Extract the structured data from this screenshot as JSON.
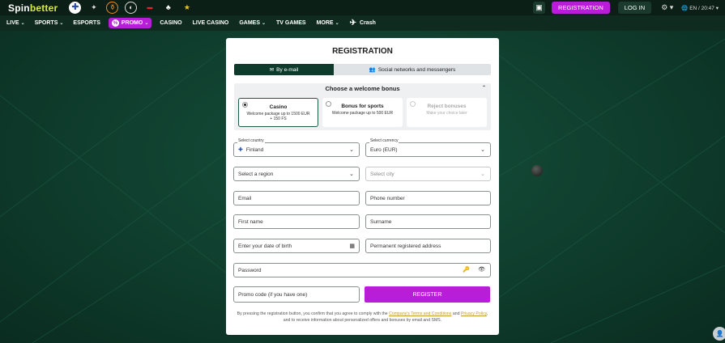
{
  "topbar": {
    "logo_left": "Spin",
    "logo_right": "better",
    "sport_icons": [
      "finland-flag-icon",
      "champions-league-icon",
      "europa-league-icon",
      "tennis-ball-icon",
      "ufc-icon",
      "cricket-icon",
      "stars-icon"
    ],
    "registration_label": "Registration",
    "login_label": "Log in",
    "lang": "EN",
    "time": "20:47"
  },
  "nav": {
    "items": [
      "Live",
      "Sports",
      "Esports",
      "Promo",
      "Casino",
      "Live Casino",
      "Games",
      "TV Games",
      "More",
      "Crash"
    ]
  },
  "form": {
    "title": "REGISTRATION",
    "tab_email": "By e-mail",
    "tab_social": "Social networks and messengers",
    "bonus_heading": "Choose a welcome bonus",
    "bonuses": [
      {
        "title": "Casino",
        "desc": "Welcome package up to 1500 EUR + 150 FS",
        "selected": true
      },
      {
        "title": "Bonus for sports",
        "desc": "Welcome package up to 500 EUR",
        "selected": false
      },
      {
        "title": "Reject bonuses",
        "desc": "Make your choice later",
        "selected": false
      }
    ],
    "country_label": "Select country",
    "country_value": "Finland",
    "currency_label": "Select currency",
    "currency_value": "Euro (EUR)",
    "region_placeholder": "Select a region",
    "city_placeholder": "Select city",
    "email_placeholder": "Email",
    "phone_placeholder": "Phone number",
    "firstname_placeholder": "First name",
    "surname_placeholder": "Surname",
    "dob_placeholder": "Enter your date of birth",
    "address_placeholder": "Permanent registered address",
    "password_placeholder": "Password",
    "promo_placeholder": "Promo code (if you have one)",
    "register_label": "Register",
    "legal_1": "By pressing the registration button, you confirm that you agree to comply with the",
    "legal_link1": "Company's Terms and Conditions",
    "legal_and": "and",
    "legal_link2": "Privacy Policy",
    "legal_2": ", and to receive information about personalized offers and bonuses by email and SMS."
  },
  "colors": {
    "accent": "#b81ed8",
    "brand_dark": "#0f3b2c",
    "link": "#c19a2d"
  }
}
